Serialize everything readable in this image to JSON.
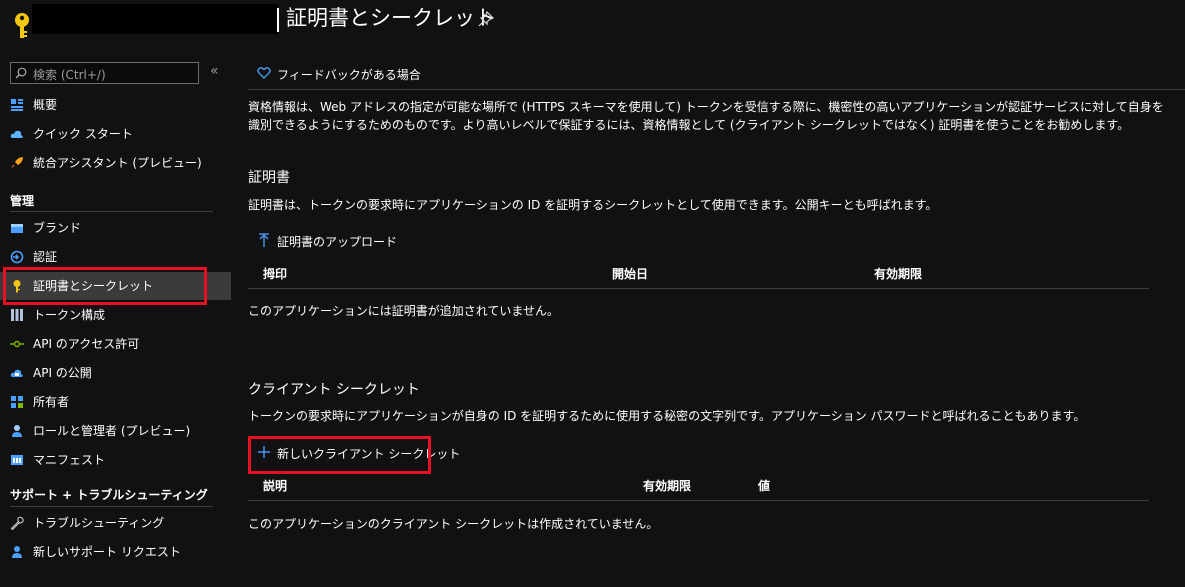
{
  "header": {
    "title": "証明書とシークレット",
    "app_icon": "key-icon",
    "pin_icon": "pin-icon"
  },
  "sidebar": {
    "search_placeholder": "検索 (Ctrl+/)",
    "collapse_label": "«",
    "top_items": [
      {
        "label": "概要",
        "icon": "overview-icon"
      },
      {
        "label": "クイック スタート",
        "icon": "cloud-icon"
      },
      {
        "label": "統合アシスタント (プレビュー)",
        "icon": "rocket-icon"
      }
    ],
    "manage_heading": "管理",
    "manage_items": [
      {
        "label": "ブランド",
        "icon": "branding-icon"
      },
      {
        "label": "認証",
        "icon": "authentication-icon"
      },
      {
        "label": "証明書とシークレット",
        "icon": "key-icon",
        "active": true
      },
      {
        "label": "トークン構成",
        "icon": "token-icon"
      },
      {
        "label": "API のアクセス許可",
        "icon": "api-permissions-icon"
      },
      {
        "label": "API の公開",
        "icon": "expose-api-icon"
      },
      {
        "label": "所有者",
        "icon": "owners-icon"
      },
      {
        "label": "ロールと管理者 (プレビュー)",
        "icon": "roles-icon"
      },
      {
        "label": "マニフェスト",
        "icon": "manifest-icon"
      }
    ],
    "support_heading": "サポート + トラブルシューティング",
    "support_items": [
      {
        "label": "トラブルシューティング",
        "icon": "wrench-icon"
      },
      {
        "label": "新しいサポート リクエスト",
        "icon": "support-person-icon"
      }
    ]
  },
  "main": {
    "feedback_label": "フィードバックがある場合",
    "intro_text": "資格情報は、Web アドレスの指定が可能な場所で (HTTPS スキーマを使用して) トークンを受信する際に、機密性の高いアプリケーションが認証サービスに対して自身を識別できるようにするためのものです。より高いレベルで保証するには、資格情報として (クライアント シークレットではなく) 証明書を使うことをお勧めします。",
    "certificates": {
      "title": "証明書",
      "description": "証明書は、トークンの要求時にアプリケーションの ID を証明するシークレットとして使用できます。公開キーとも呼ばれます。",
      "upload_label": "証明書のアップロード",
      "columns": [
        "拇印",
        "開始日",
        "有効期限"
      ],
      "empty_message": "このアプリケーションには証明書が追加されていません。"
    },
    "secrets": {
      "title": "クライアント シークレット",
      "description": "トークンの要求時にアプリケーションが自身の ID を証明するために使用する秘密の文字列です。アプリケーション パスワードと呼ばれることもあります。",
      "new_label": "新しいクライアント シークレット",
      "columns": [
        "説明",
        "有効期限",
        "値"
      ],
      "empty_message": "このアプリケーションのクライアント シークレットは作成されていません。"
    }
  },
  "colors": {
    "background": "#111111",
    "highlight": "#e81123",
    "accent": "#4aa0ff",
    "active_item": "#3b3b3b"
  }
}
